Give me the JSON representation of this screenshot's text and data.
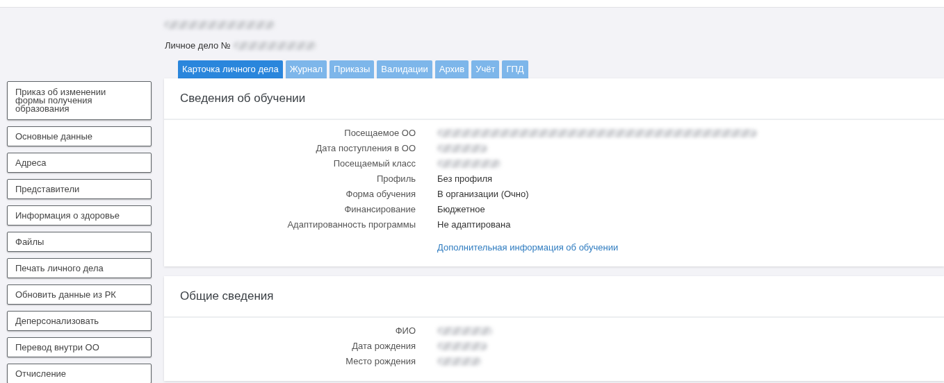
{
  "header": {
    "title": {
      "kind": "redacted"
    },
    "case_label": "Личное дело №",
    "case_number": {
      "kind": "redacted"
    }
  },
  "tabs": [
    {
      "label": "Карточка личного дела",
      "selected": true
    },
    {
      "label": "Журнал",
      "selected": false
    },
    {
      "label": "Приказы",
      "selected": false
    },
    {
      "label": "Валидации",
      "selected": false
    },
    {
      "label": "Архив",
      "selected": false
    },
    {
      "label": "Учёт",
      "selected": false
    },
    {
      "label": "ГПД",
      "selected": false
    }
  ],
  "sidebar": {
    "items": [
      "Приказ об изменении формы получения образования",
      "Основные данные",
      "Адреса",
      "Представители",
      "Информация о здоровье",
      "Файлы",
      "Печать личного дела",
      "Обновить данные из РК",
      "Деперсонализовать",
      "Перевод внутри ОО",
      "Отчисление"
    ]
  },
  "sections": [
    {
      "title": "Сведения об обучении",
      "fields": [
        {
          "label": "Посещаемое ОО",
          "kind": "redacted"
        },
        {
          "label": "Дата поступления в ОО",
          "kind": "redacted"
        },
        {
          "label": "Посещаемый класс",
          "kind": "redacted"
        },
        {
          "label": "Профиль",
          "kind": "text",
          "value": "Без профиля"
        },
        {
          "label": "Форма обучения",
          "kind": "text",
          "value": "В организации (Очно)"
        },
        {
          "label": "Финансирование",
          "kind": "text",
          "value": "Бюджетное"
        },
        {
          "label": "Адаптированность программы",
          "kind": "text",
          "value": "Не адаптирована"
        }
      ],
      "link": "Дополнительная информация об обучении"
    },
    {
      "title": "Общие сведения",
      "fields": [
        {
          "label": "ФИО",
          "kind": "redacted"
        },
        {
          "label": "Дата рождения",
          "kind": "redacted"
        },
        {
          "label": "Место рождения",
          "kind": "redacted"
        }
      ]
    }
  ]
}
